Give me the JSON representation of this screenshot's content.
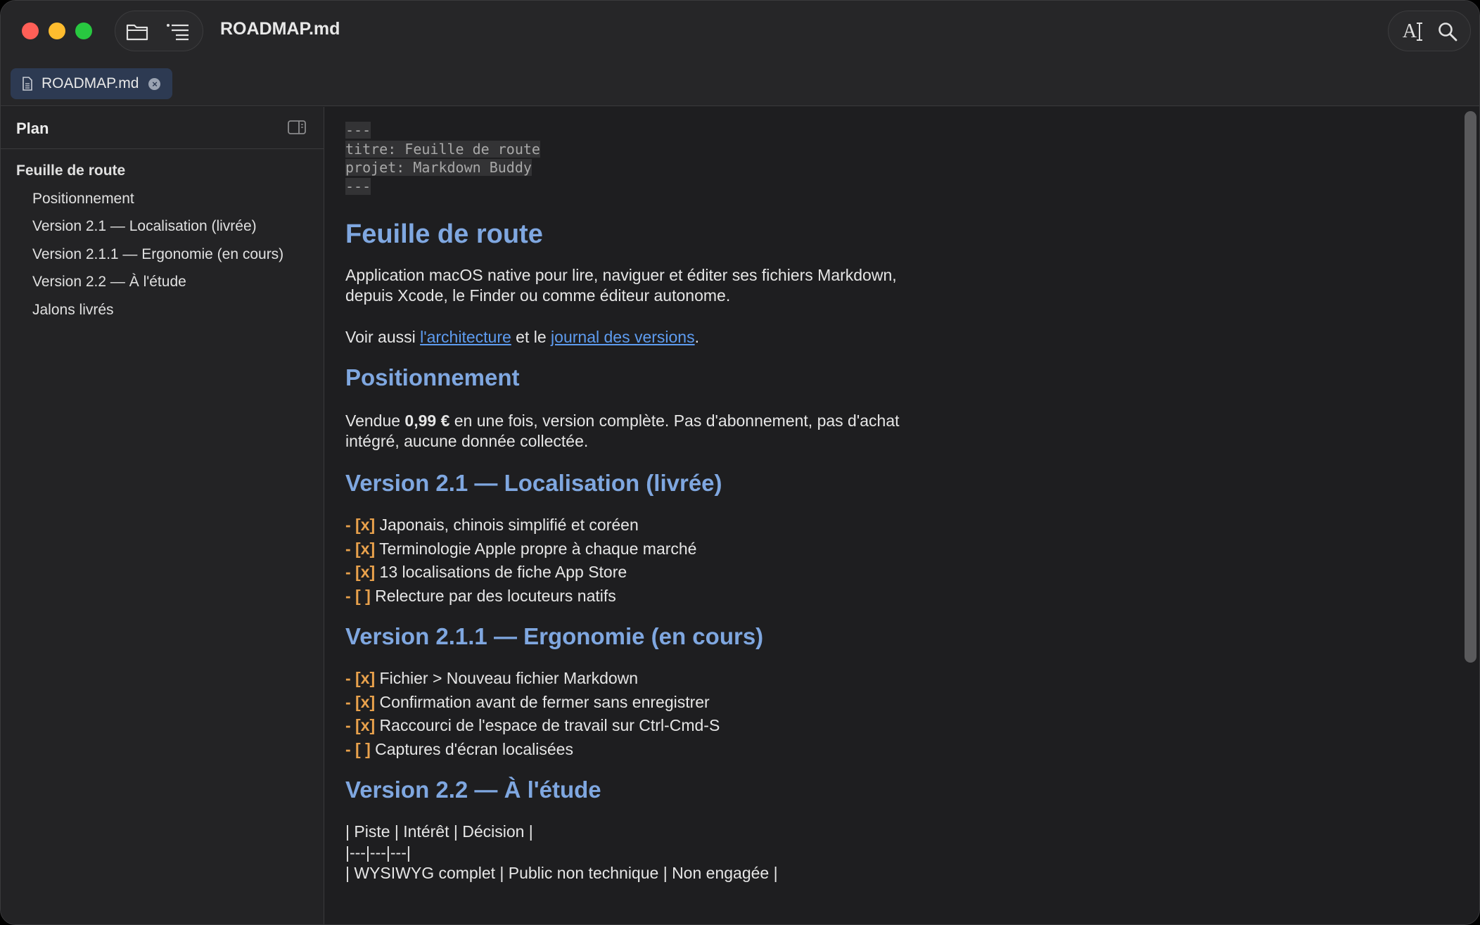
{
  "window": {
    "title": "ROADMAP.md"
  },
  "toolbar": {
    "folder_icon": "folder-icon",
    "outline_icon": "list-outline-icon",
    "font_icon": "font-size-icon",
    "search_icon": "search-icon",
    "font_glyph": "A"
  },
  "tab": {
    "label": "ROADMAP.md",
    "close_glyph": "×"
  },
  "sidebar": {
    "title": "Plan",
    "items": [
      {
        "label": "Feuille de route",
        "level": 1
      },
      {
        "label": "Positionnement",
        "level": 2
      },
      {
        "label": "Version 2.1 — Localisation (livrée)",
        "level": 2
      },
      {
        "label": "Version 2.1.1 — Ergonomie (en cours)",
        "level": 2
      },
      {
        "label": "Version 2.2 — À l'étude",
        "level": 2
      },
      {
        "label": "Jalons livrés",
        "level": 2
      }
    ]
  },
  "document": {
    "frontmatter": [
      "---",
      "titre: Feuille de route",
      "projet: Markdown Buddy",
      "---"
    ],
    "h1": "Feuille de route",
    "intro_line1": "Application macOS native pour lire, naviguer et éditer ses fichiers Markdown,",
    "intro_line2": "depuis Xcode, le Finder ou comme éditeur autonome.",
    "see_also_prefix": "Voir aussi ",
    "link_architecture": "l'architecture",
    "see_also_mid": " et le ",
    "link_journal": "journal des versions",
    "see_also_suffix": ".",
    "h2_positionnement": "Positionnement",
    "pos_prefix": "Vendue ",
    "pos_price": "0,99 €",
    "pos_rest": " en une fois, version complète. Pas d'abonnement, pas d'achat",
    "pos_line2": "intégré, aucune donnée collectée.",
    "h2_v21": "Version 2.1 — Localisation (livrée)",
    "v21_tasks": [
      {
        "mark": "- [x]",
        "text": " Japonais, chinois simplifié et coréen"
      },
      {
        "mark": "- [x]",
        "text": " Terminologie Apple propre à chaque marché"
      },
      {
        "mark": "- [x]",
        "text": " 13 localisations de fiche App Store"
      },
      {
        "mark": "- [ ]",
        "text": " Relecture par des locuteurs natifs"
      }
    ],
    "h2_v211": "Version 2.1.1 — Ergonomie (en cours)",
    "v211_tasks": [
      {
        "mark": "- [x]",
        "text": " Fichier > Nouveau fichier Markdown"
      },
      {
        "mark": "- [x]",
        "text": " Confirmation avant de fermer sans enregistrer"
      },
      {
        "mark": "- [x]",
        "text": " Raccourci de l'espace de travail sur Ctrl-Cmd-S"
      },
      {
        "mark": "- [ ]",
        "text": " Captures d'écran localisées"
      }
    ],
    "h2_v22": "Version 2.2 — À l'étude",
    "table_lines": [
      "| Piste | Intérêt | Décision |",
      "|---|---|---|",
      "| WYSIWYG complet | Public non technique | Non engagée |"
    ]
  }
}
